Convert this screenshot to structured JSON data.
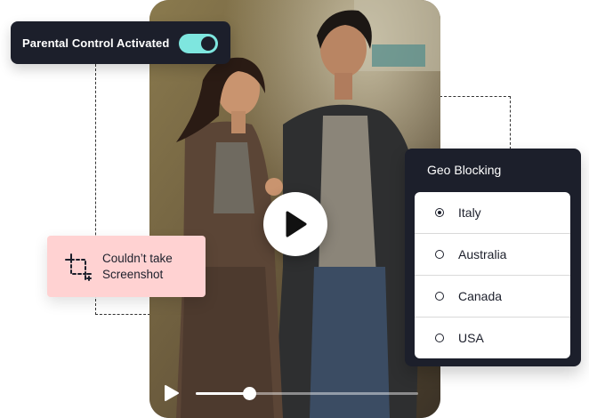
{
  "parental_control": {
    "label": "Parental Control Activated",
    "toggle_on": true,
    "toggle_color": "#7ee6df"
  },
  "screenshot_notice": {
    "line1": "Couldn’t take",
    "line2": "Screenshot",
    "icon": "crop-icon",
    "background": "#ffd2d2"
  },
  "geo_blocking": {
    "title": "Geo Blocking",
    "options": [
      {
        "label": "Italy",
        "selected": true
      },
      {
        "label": "Australia",
        "selected": false
      },
      {
        "label": "Canada",
        "selected": false
      },
      {
        "label": "USA",
        "selected": false
      }
    ]
  },
  "video": {
    "play_icon": "play-icon",
    "progress_fraction": 0.24
  },
  "colors": {
    "panel_dark": "#1c1f2b",
    "accent": "#7ee6df"
  }
}
